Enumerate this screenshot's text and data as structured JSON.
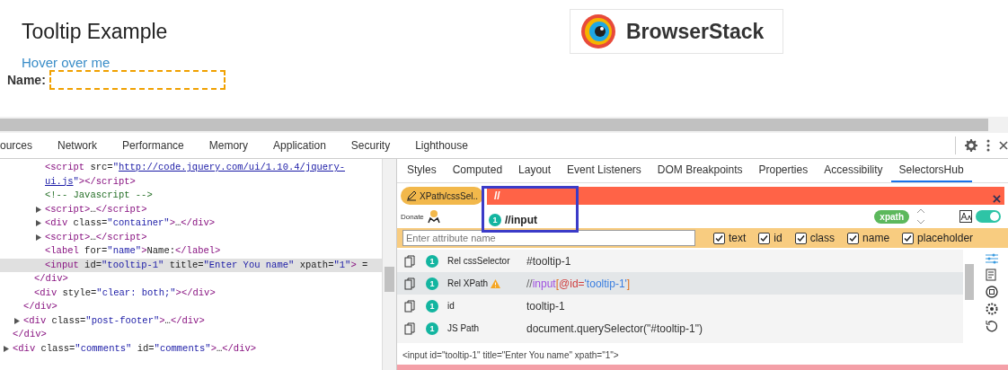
{
  "page": {
    "title": "Tooltip Example",
    "link": "Hover over me",
    "name_label": "Name:",
    "name_field": {
      "focused": true
    },
    "logo_text": "BrowserStack"
  },
  "devtools_tabs": [
    {
      "label": "ources",
      "selected": false
    },
    {
      "label": "Network",
      "selected": false
    },
    {
      "label": "Performance",
      "selected": false
    },
    {
      "label": "Memory",
      "selected": false
    },
    {
      "label": "Application",
      "selected": false
    },
    {
      "label": "Security",
      "selected": false
    },
    {
      "label": "Lighthouse",
      "selected": false
    }
  ],
  "elements": [
    {
      "children": [
        {
          "children": [
            {
              "children": [
                {
                  "text": "<script src=\"http://code.jquery.com/ui/1.10.4/jquery-ui.js\"></script>",
                  "expandable": false,
                  "selected": false
                },
                {
                  "text": "<!-- Javascript -->",
                  "expandable": false,
                  "selected": false,
                  "kind": "comment"
                },
                {
                  "text": "<script>…</script>",
                  "expandable": true,
                  "selected": false
                },
                {
                  "text": "<div class=\"container\">…</div>",
                  "expandable": true,
                  "selected": false
                },
                {
                  "text": "<script>…</script>",
                  "expandable": true,
                  "selected": false
                },
                {
                  "text": "<label for=\"name\">Name:</label>",
                  "expandable": false,
                  "selected": false
                },
                {
                  "text": "<input id=\"tooltip-1\" title=\"Enter You name\" xpath=\"1\"> =",
                  "expandable": false,
                  "selected": true
                }
              ]
            },
            {
              "text": "</div>",
              "expandable": false,
              "selected": false
            },
            {
              "text": "<div style=\"clear: both;\"></div>",
              "expandable": false,
              "selected": false
            }
          ]
        },
        {
          "text": "</div>",
          "expandable": false,
          "selected": false
        },
        {
          "text": "<div class=\"post-footer\">…</div>",
          "expandable": true,
          "selected": false
        }
      ]
    },
    {
      "text": "</div>",
      "expandable": false,
      "selected": false
    },
    {
      "text": "<div class=\"comments\" id=\"comments\">…</div>",
      "expandable": true,
      "selected": false
    }
  ],
  "side_tabs": [
    {
      "label": "Styles",
      "selected": false
    },
    {
      "label": "Computed",
      "selected": false
    },
    {
      "label": "Layout",
      "selected": false
    },
    {
      "label": "Event Listeners",
      "selected": false
    },
    {
      "label": "DOM Breakpoints",
      "selected": false
    },
    {
      "label": "Properties",
      "selected": false
    },
    {
      "label": "Accessibility",
      "selected": false
    },
    {
      "label": "SelectorsHub",
      "selected": true
    }
  ],
  "selectorshub": {
    "mode_button": "XPath/cssSel..",
    "selector_value": "//",
    "donate": "Donate",
    "suggestion": {
      "count": "1",
      "text": "//input"
    },
    "type_badge": "xpath",
    "toggle_on": true,
    "attribute_placeholder": "Enter attribute name",
    "attributes": [
      {
        "label": "text",
        "checked": true
      },
      {
        "label": "id",
        "checked": true
      },
      {
        "label": "class",
        "checked": true
      },
      {
        "label": "name",
        "checked": true
      },
      {
        "label": "placeholder",
        "checked": true
      }
    ],
    "results": [
      {
        "count": "1",
        "label": "Rel cssSelector",
        "warning": false,
        "selected": false,
        "value": [
          {
            "kind": "plain",
            "text": "#tooltip-1"
          }
        ]
      },
      {
        "count": "1",
        "label": "Rel XPath",
        "warning": true,
        "selected": true,
        "value": [
          {
            "kind": "slash",
            "text": "//"
          },
          {
            "kind": "tag",
            "text": "input"
          },
          {
            "kind": "bracket",
            "text": "["
          },
          {
            "kind": "attr",
            "text": "@id="
          },
          {
            "kind": "string",
            "text": "'tooltip-1'"
          },
          {
            "kind": "bracket",
            "text": "]"
          }
        ]
      },
      {
        "count": "1",
        "label": "id",
        "warning": false,
        "selected": false,
        "value": [
          {
            "kind": "plain",
            "text": "tooltip-1"
          }
        ]
      },
      {
        "count": "1",
        "label": "JS Path",
        "warning": false,
        "selected": false,
        "value": [
          {
            "kind": "plain",
            "text": "document.querySelector(\"#tooltip-1\")"
          }
        ]
      }
    ],
    "element_html": "<input id=\"tooltip-1\" title=\"Enter You name\" xpath=\"1\">"
  }
}
